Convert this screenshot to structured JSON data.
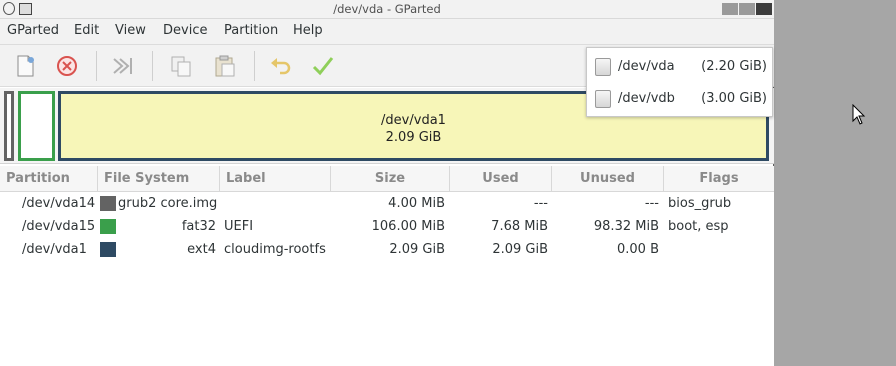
{
  "window": {
    "title": "/dev/vda - GParted"
  },
  "menubar": {
    "items": [
      "GParted",
      "Edit",
      "View",
      "Device",
      "Partition",
      "Help"
    ]
  },
  "toolbar": {
    "buttons": [
      "new-icon",
      "delete-icon",
      "resize-move-icon",
      "copy-icon",
      "paste-icon",
      "undo-icon",
      "apply-icon"
    ]
  },
  "diskmap": {
    "main_partition": {
      "name": "/dev/vda1",
      "size": "2.09 GiB"
    }
  },
  "table": {
    "columns": [
      "Partition",
      "File System",
      "Label",
      "Size",
      "Used",
      "Unused",
      "Flags"
    ],
    "rows": [
      {
        "partition": "/dev/vda14",
        "fs": "grub2 core.img",
        "fs_color": "#636363",
        "label": "",
        "size": "4.00 MiB",
        "used": "---",
        "unused": "---",
        "flags": "bios_grub"
      },
      {
        "partition": "/dev/vda15",
        "fs": "fat32",
        "fs_color": "#3a9f4b",
        "label": "UEFI",
        "size": "106.00 MiB",
        "used": "7.68 MiB",
        "unused": "98.32 MiB",
        "flags": "boot, esp"
      },
      {
        "partition": "/dev/vda1",
        "fs": "ext4",
        "fs_color": "#2e4a63",
        "label": "cloudimg-rootfs",
        "size": "2.09 GiB",
        "used": "2.09 GiB",
        "unused": "0.00 B",
        "flags": ""
      }
    ]
  },
  "device_menu": {
    "items": [
      {
        "name": "/dev/vda",
        "size": "(2.20 GiB)"
      },
      {
        "name": "/dev/vdb",
        "size": "(3.00 GiB)"
      }
    ]
  }
}
